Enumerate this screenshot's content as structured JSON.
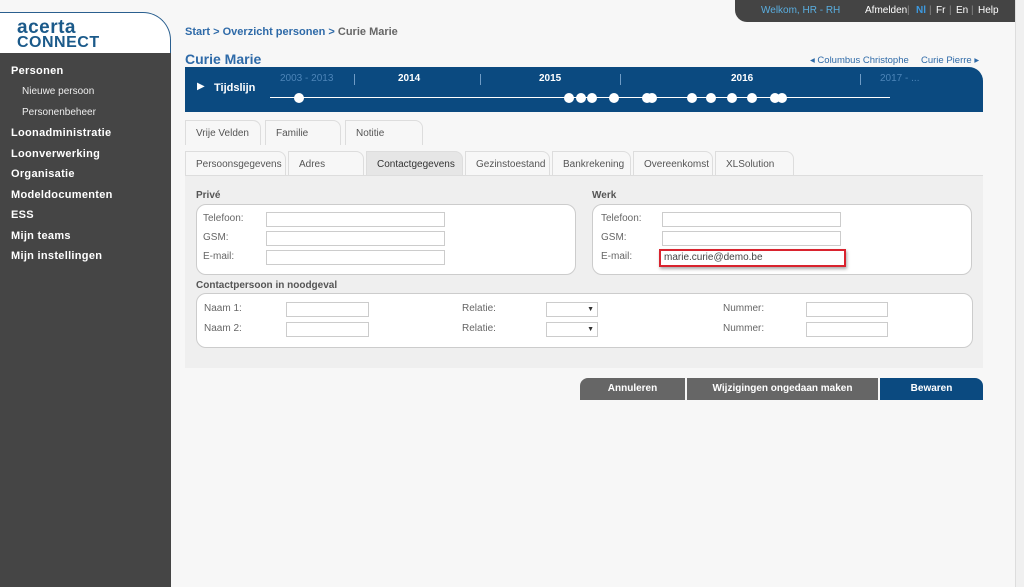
{
  "topbar": {
    "welcome": "Welkom, HR - RH",
    "logout": "Afmelden",
    "languages": [
      "Nl",
      "Fr",
      "En"
    ],
    "help": "Help",
    "active_language": "Nl"
  },
  "logo": {
    "line1": "acerta",
    "line2": "connect"
  },
  "sidebar": {
    "items": [
      {
        "label": "Personen",
        "sub": [
          "Nieuwe persoon",
          "Personenbeheer"
        ]
      },
      {
        "label": "Loonadministratie"
      },
      {
        "label": "Loonverwerking"
      },
      {
        "label": "Organisatie"
      },
      {
        "label": "Modeldocumenten"
      },
      {
        "label": "ESS"
      },
      {
        "label": "Mijn teams"
      },
      {
        "label": "Mijn instellingen"
      }
    ]
  },
  "breadcrumb": {
    "items": [
      "Start",
      "Overzicht personen"
    ],
    "current": "Curie Marie",
    "separator": ">"
  },
  "page_title": "Curie Marie",
  "person_nav": {
    "prev": "Columbus Christophe",
    "next": "Curie Pierre"
  },
  "timeline": {
    "label": "Tijdslijn",
    "periods": [
      "2003 - 2013",
      "2014",
      "2015",
      "2016",
      "2017 - ..."
    ]
  },
  "tabs_row1": [
    "Vrije Velden",
    "Familie",
    "Notitie"
  ],
  "tabs_row2": [
    "Persoonsgegevens",
    "Adres",
    "Contactgegevens",
    "Gezinstoestand",
    "Bankrekening",
    "Overeenkomst",
    "XLSolution"
  ],
  "active_tab": "Contactgegevens",
  "prive": {
    "title": "Privé",
    "telefoon_label": "Telefoon:",
    "gsm_label": "GSM:",
    "email_label": "E-mail:",
    "telefoon": "",
    "gsm": "",
    "email": ""
  },
  "werk": {
    "title": "Werk",
    "telefoon_label": "Telefoon:",
    "gsm_label": "GSM:",
    "email_label": "E-mail:",
    "telefoon": "",
    "gsm": "",
    "email": "marie.curie@demo.be"
  },
  "noodgeval": {
    "title": "Contactpersoon in noodgeval",
    "naam1_label": "Naam 1:",
    "naam2_label": "Naam 2:",
    "relatie_label": "Relatie:",
    "nummer_label": "Nummer:"
  },
  "buttons": {
    "cancel": "Annuleren",
    "undo": "Wijzigingen ongedaan maken",
    "save": "Bewaren"
  },
  "colors": {
    "brand": "#0b4a80",
    "sidebar": "#454545",
    "highlight": "#d9232e"
  }
}
